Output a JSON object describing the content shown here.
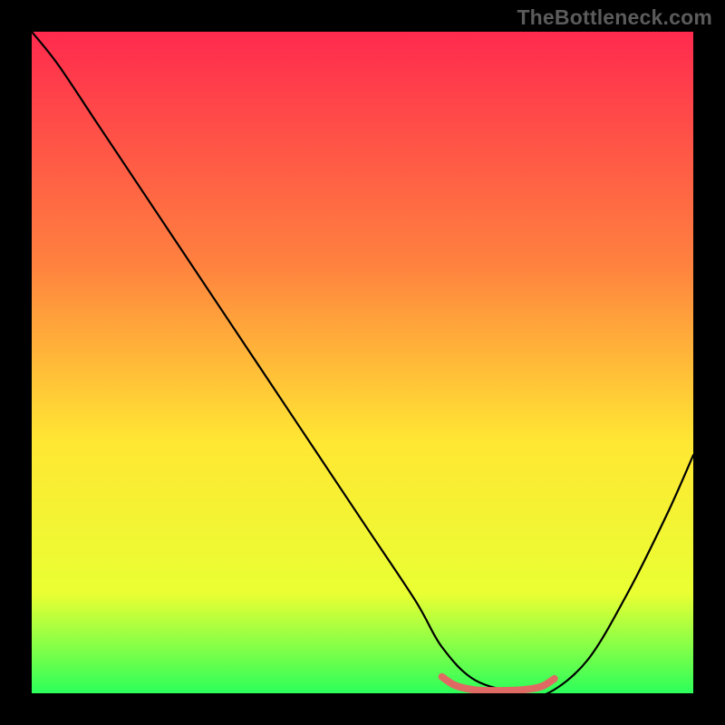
{
  "watermark": "TheBottleneck.com",
  "chart_data": {
    "type": "line",
    "title": "",
    "xlabel": "",
    "ylabel": "",
    "xlim": [
      0,
      100
    ],
    "ylim": [
      0,
      100
    ],
    "grid": false,
    "background_gradient": {
      "top": "#ff2a4e",
      "mid_upper": "#ff813f",
      "mid": "#ffe733",
      "mid_lower": "#e9ff33",
      "bottom": "#2cff5a"
    },
    "series": [
      {
        "name": "bottleneck-curve",
        "color": "#000000",
        "x": [
          0,
          4,
          10,
          20,
          30,
          40,
          50,
          58,
          62,
          67,
          74,
          78,
          84,
          90,
          96,
          100
        ],
        "y": [
          100,
          95,
          86,
          71,
          56,
          41,
          26,
          14,
          7,
          2,
          0,
          0,
          5,
          15,
          27,
          36
        ]
      },
      {
        "name": "optimal-range-marker",
        "color": "#df6a64",
        "x": [
          62,
          64,
          67,
          70,
          74,
          77,
          79
        ],
        "y": [
          2.5,
          1.2,
          0.5,
          0.4,
          0.5,
          1.0,
          2.2
        ]
      }
    ],
    "legend": null
  }
}
